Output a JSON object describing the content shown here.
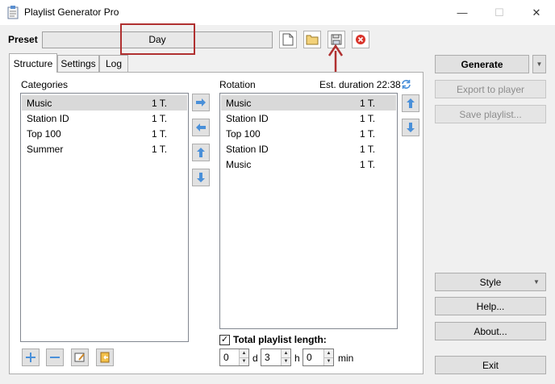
{
  "window": {
    "title": "Playlist Generator Pro"
  },
  "preset": {
    "label": "Preset",
    "value": "Day"
  },
  "tabs": [
    {
      "label": "Structure"
    },
    {
      "label": "Settings"
    },
    {
      "label": "Log"
    }
  ],
  "categories": {
    "label": "Categories",
    "items": [
      {
        "name": "Music",
        "count": "1 T."
      },
      {
        "name": "Station ID",
        "count": "1 T."
      },
      {
        "name": "Top 100",
        "count": "1 T."
      },
      {
        "name": "Summer",
        "count": "1 T."
      }
    ]
  },
  "rotation": {
    "label": "Rotation",
    "duration": "Est. duration 22:38",
    "items": [
      {
        "name": "Music",
        "count": "1 T."
      },
      {
        "name": "Station ID",
        "count": "1 T."
      },
      {
        "name": "Top 100",
        "count": "1 T."
      },
      {
        "name": "Station ID",
        "count": "1 T."
      },
      {
        "name": "Music",
        "count": "1 T."
      }
    ]
  },
  "total_length": {
    "label": "Total playlist length:",
    "checked": true,
    "days": "0",
    "days_unit": "d",
    "hours": "3",
    "hours_unit": "h",
    "minutes": "0",
    "minutes_unit": "min"
  },
  "buttons": {
    "generate": "Generate",
    "export": "Export to player",
    "save_playlist": "Save playlist...",
    "style": "Style",
    "help": "Help...",
    "about": "About...",
    "exit": "Exit"
  },
  "colors": {
    "annotation": "#b03030",
    "arrow_blue": "#4a90d9",
    "selection": "#d9d9d9"
  }
}
